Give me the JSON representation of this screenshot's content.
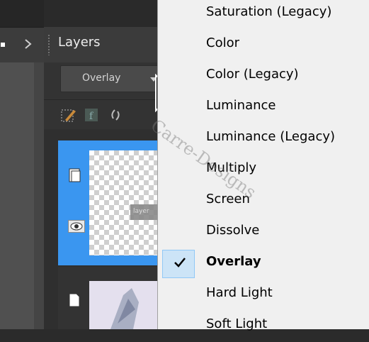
{
  "layers_panel": {
    "title": "Layers",
    "blend_mode": "Overlay",
    "thumb_caption": "layer"
  },
  "blend_menu": {
    "items": [
      {
        "label": "Saturation (Legacy)",
        "checked": false
      },
      {
        "label": "Color",
        "checked": false
      },
      {
        "label": "Color (Legacy)",
        "checked": false
      },
      {
        "label": "Luminance",
        "checked": false
      },
      {
        "label": "Luminance (Legacy)",
        "checked": false
      },
      {
        "label": "Multiply",
        "checked": false
      },
      {
        "label": "Screen",
        "checked": false
      },
      {
        "label": "Dissolve",
        "checked": false
      },
      {
        "label": "Overlay",
        "checked": true
      },
      {
        "label": "Hard Light",
        "checked": false
      },
      {
        "label": "Soft Light",
        "checked": false
      }
    ]
  },
  "watermark": "Carre-Designs",
  "colors": {
    "selection_blue": "#3a96f0",
    "menu_bg": "#f0f0f0",
    "check_highlight": "#cce4f7"
  },
  "icons": [
    "arrow-right-icon",
    "paint-brush-icon",
    "fx-icon",
    "link-icon",
    "page-icon",
    "eye-icon",
    "cursor-icon",
    "checkmark-icon"
  ]
}
